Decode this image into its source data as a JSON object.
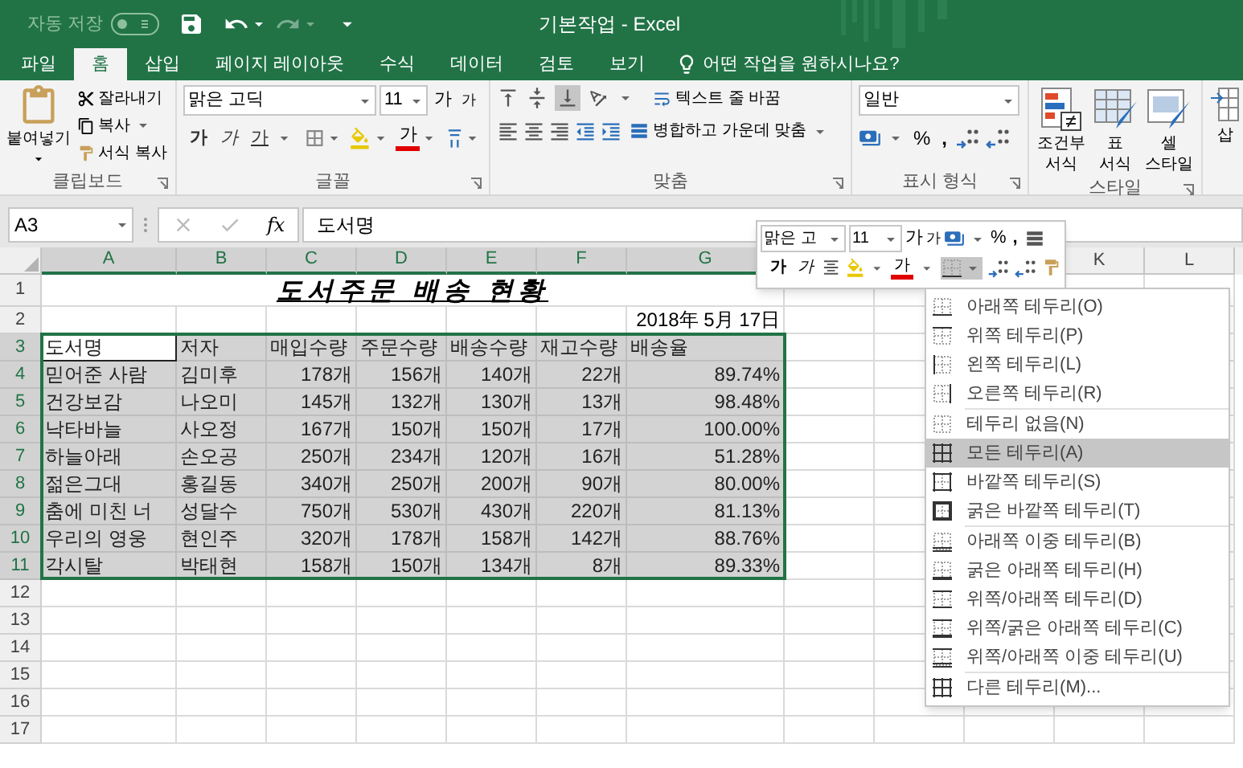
{
  "title_bar": {
    "autosave_label": "자동 저장",
    "autosave_on": false,
    "title": "기본작업 - Excel"
  },
  "tabs": [
    {
      "label": "파일",
      "selected": false
    },
    {
      "label": "홈",
      "selected": true
    },
    {
      "label": "삽입",
      "selected": false
    },
    {
      "label": "페이지 레이아웃",
      "selected": false
    },
    {
      "label": "수식",
      "selected": false
    },
    {
      "label": "데이터",
      "selected": false
    },
    {
      "label": "검토",
      "selected": false
    },
    {
      "label": "보기",
      "selected": false
    }
  ],
  "tell_me": "어떤 작업을 원하시나요?",
  "ribbon": {
    "clipboard": {
      "label": "클립보드",
      "paste": "붙여넣기",
      "cut": "잘라내기",
      "copy": "복사",
      "format_painter": "서식 복사"
    },
    "font": {
      "label": "글꼴",
      "name": "맑은 고딕",
      "size": "11",
      "grow": "가",
      "shrink": "가",
      "bold": "가",
      "italic": "가",
      "underline": "가",
      "font_color": "가"
    },
    "alignment": {
      "label": "맞춤",
      "wrap": "텍스트 줄 바꿈",
      "merge": "병합하고 가운데 맞춤"
    },
    "number": {
      "label": "표시 형식",
      "format": "일반",
      "percent": "%",
      "comma": ","
    },
    "styles": {
      "label": "스타일",
      "buttons": [
        {
          "kind": "conditional",
          "lines": [
            "조건부",
            "서식"
          ]
        },
        {
          "kind": "table",
          "lines": [
            "표",
            "서식"
          ]
        },
        {
          "kind": "cell",
          "lines": [
            "셀",
            "스타일"
          ]
        }
      ]
    },
    "cells": {
      "insert": "삽"
    }
  },
  "formula_bar": {
    "name_box": "A3",
    "function_label": "fx",
    "content": "도서명"
  },
  "mini_toolbar": {
    "font": "맑은 고",
    "size": "11",
    "grow": "가",
    "shrink": "가",
    "percent": "%",
    "comma": ",",
    "bold": "가",
    "italic": "가",
    "font_color": "가"
  },
  "sheet": {
    "columns": [
      {
        "label": "A",
        "selected": true
      },
      {
        "label": "B",
        "selected": true
      },
      {
        "label": "C",
        "selected": true
      },
      {
        "label": "D",
        "selected": true
      },
      {
        "label": "E",
        "selected": true
      },
      {
        "label": "F",
        "selected": true
      },
      {
        "label": "G",
        "selected": true
      },
      {},
      {},
      {},
      {
        "label": "K",
        "selected": false
      },
      {
        "label": "L",
        "selected": false
      }
    ],
    "rows": [
      {
        "number": "1",
        "kind": "title",
        "selected": false,
        "text": "도서주문 배송 현황"
      },
      {
        "number": "2",
        "kind": "date",
        "selected": false,
        "text": "2018年 5月 17日"
      },
      {
        "number": "3",
        "kind": "header",
        "selected": true,
        "active": true,
        "cells": [
          "도서명",
          "저자",
          "매입수량",
          "주문수량",
          "배송수량",
          "재고수량",
          "배송율"
        ]
      },
      {
        "number": "4",
        "kind": "data",
        "selected": true,
        "cells": [
          "믿어준 사람",
          "김미후",
          "178개",
          "156개",
          "140개",
          "22개",
          "89.74%"
        ]
      },
      {
        "number": "5",
        "kind": "data",
        "selected": true,
        "cells": [
          "건강보감",
          "나오미",
          "145개",
          "132개",
          "130개",
          "13개",
          "98.48%"
        ]
      },
      {
        "number": "6",
        "kind": "data",
        "selected": true,
        "cells": [
          "낙타바늘",
          "사오정",
          "167개",
          "150개",
          "150개",
          "17개",
          "100.00%"
        ]
      },
      {
        "number": "7",
        "kind": "data",
        "selected": true,
        "cells": [
          "하늘아래",
          "손오공",
          "250개",
          "234개",
          "120개",
          "16개",
          "51.28%"
        ]
      },
      {
        "number": "8",
        "kind": "data",
        "selected": true,
        "cells": [
          "젊은그대",
          "홍길동",
          "340개",
          "250개",
          "200개",
          "90개",
          "80.00%"
        ]
      },
      {
        "number": "9",
        "kind": "data",
        "selected": true,
        "cells": [
          "춤에 미친 너",
          "성달수",
          "750개",
          "530개",
          "430개",
          "220개",
          "81.13%"
        ]
      },
      {
        "number": "10",
        "kind": "data",
        "selected": true,
        "cells": [
          "우리의 영웅",
          "현인주",
          "320개",
          "178개",
          "158개",
          "142개",
          "88.76%"
        ]
      },
      {
        "number": "11",
        "kind": "data",
        "selected": true,
        "cells": [
          "각시탈",
          "박태현",
          "158개",
          "150개",
          "134개",
          "8개",
          "89.33%"
        ]
      },
      {
        "number": "12",
        "kind": "empty",
        "selected": false
      },
      {
        "number": "13",
        "kind": "empty",
        "selected": false
      },
      {
        "number": "14",
        "kind": "empty",
        "selected": false
      },
      {
        "number": "15",
        "kind": "empty",
        "selected": false
      },
      {
        "number": "16",
        "kind": "empty",
        "selected": false
      },
      {
        "number": "17",
        "kind": "empty",
        "selected": false
      }
    ]
  },
  "border_menu": {
    "groups": [
      [
        {
          "label": "아래쪽 테두리(O)",
          "kind": "bottom",
          "selected": false
        },
        {
          "label": "위쪽 테두리(P)",
          "kind": "top",
          "selected": false
        },
        {
          "label": "왼쪽 테두리(L)",
          "kind": "left",
          "selected": false
        },
        {
          "label": "오른쪽 테두리(R)",
          "kind": "right",
          "selected": false
        }
      ],
      [
        {
          "label": "테두리 없음(N)",
          "kind": "none",
          "selected": false
        },
        {
          "label": "모든 테두리(A)",
          "kind": "all",
          "selected": true
        },
        {
          "label": "바깥쪽 테두리(S)",
          "kind": "outside",
          "selected": false
        },
        {
          "label": "굵은 바깥쪽 테두리(T)",
          "kind": "thick_outside",
          "selected": false
        }
      ],
      [
        {
          "label": "아래쪽 이중 테두리(B)",
          "kind": "double_bottom",
          "selected": false
        },
        {
          "label": "굵은 아래쪽 테두리(H)",
          "kind": "thick_bottom",
          "selected": false
        },
        {
          "label": "위쪽/아래쪽 테두리(D)",
          "kind": "top_bottom",
          "selected": false
        },
        {
          "label": "위쪽/굵은 아래쪽 테두리(C)",
          "kind": "top_thick_bottom",
          "selected": false
        },
        {
          "label": "위쪽/아래쪽 이중 테두리(U)",
          "kind": "top_double_bottom",
          "selected": false
        }
      ],
      [
        {
          "label": "다른 테두리(M)...",
          "kind": "all",
          "selected": false
        }
      ]
    ]
  }
}
